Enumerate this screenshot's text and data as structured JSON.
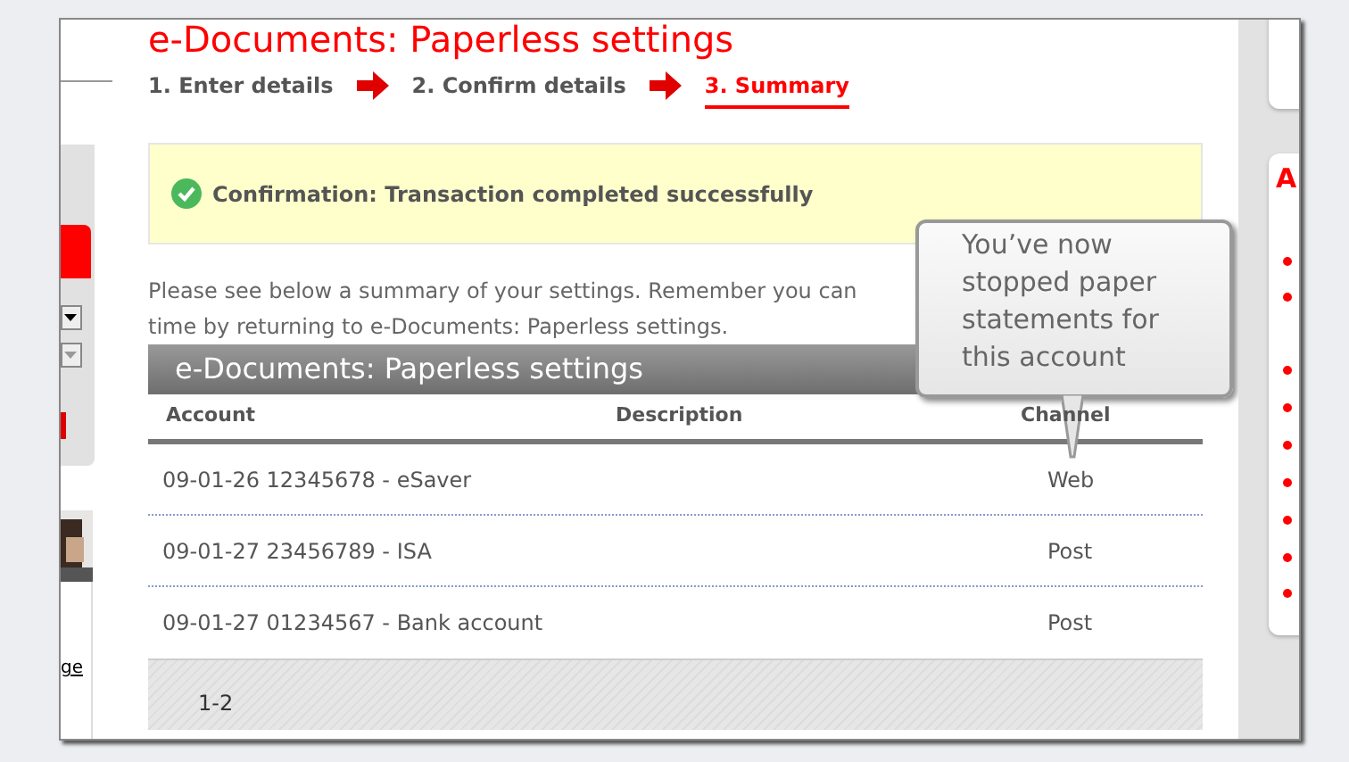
{
  "page_title": "e-Documents: Paperless settings",
  "steps": [
    {
      "label": "1. Enter details",
      "selected": false
    },
    {
      "label": "2. Confirm details",
      "selected": false
    },
    {
      "label": "3. Summary",
      "selected": true
    }
  ],
  "confirmation": "Confirmation: Transaction completed successfully",
  "intro": [
    "Please see below a summary of your settings. Remember you can",
    "time by returning to e-Documents: Paperless settings."
  ],
  "table": {
    "title": "e-Documents: Paperless settings",
    "columns": [
      "Account",
      "Description",
      "Channel"
    ],
    "rows": [
      {
        "account": "09-01-26 12345678 - eSaver",
        "channel": "Web"
      },
      {
        "account": "09-01-27 23456789 - ISA",
        "channel": "Post"
      },
      {
        "account": "09-01-27 01234567 - Bank account",
        "channel": "Post"
      }
    ],
    "footer": "1-2"
  },
  "tooltip": "You’ve now stopped paper statements for this account",
  "left_panel": {
    "link": "ge"
  },
  "right_panel": {
    "heading": "A"
  }
}
